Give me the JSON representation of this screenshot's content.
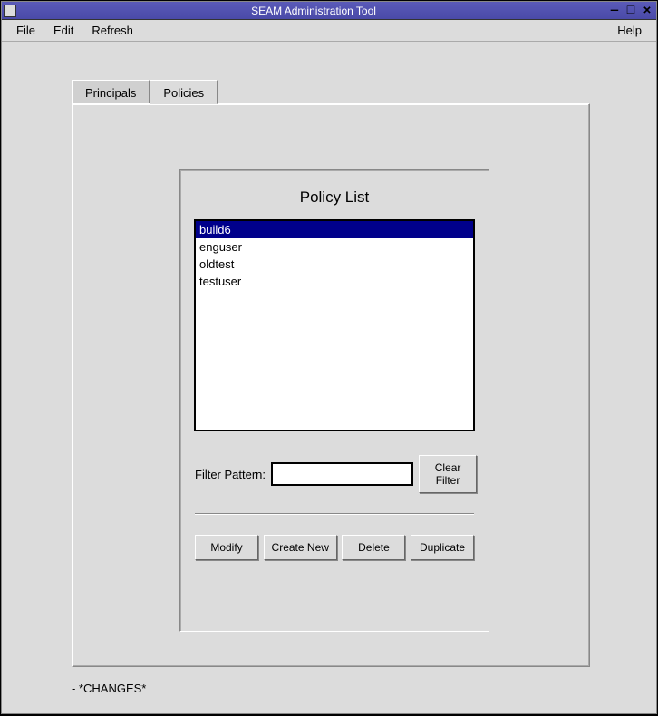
{
  "window": {
    "title": "SEAM Administration Tool"
  },
  "menubar": {
    "file": "File",
    "edit": "Edit",
    "refresh": "Refresh",
    "help": "Help"
  },
  "tabs": {
    "principals": "Principals",
    "policies": "Policies",
    "active": "policies"
  },
  "panel": {
    "title": "Policy List",
    "items": [
      "build6",
      "enguser",
      "oldtest",
      "testuser"
    ],
    "selected_index": 0
  },
  "filter": {
    "label": "Filter Pattern:",
    "value": "",
    "clear_label": "Clear Filter"
  },
  "actions": {
    "modify": "Modify",
    "create_new": "Create New",
    "delete": "Delete",
    "duplicate": "Duplicate"
  },
  "status": "- *CHANGES*"
}
